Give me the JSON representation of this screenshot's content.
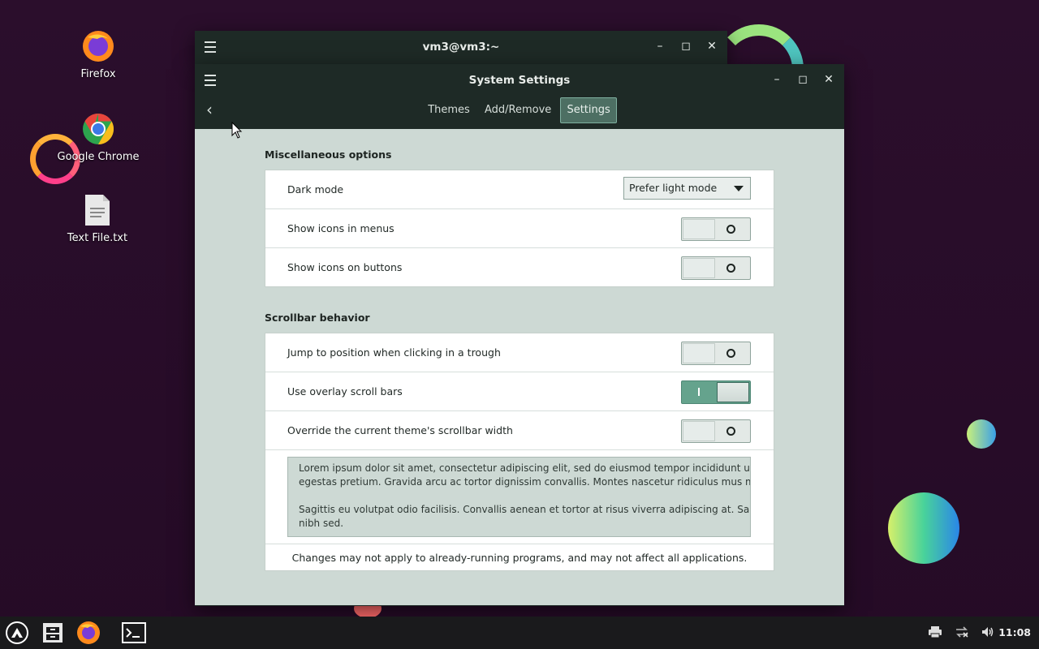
{
  "desktop": {
    "icons": [
      {
        "label": "Firefox",
        "icon": "firefox-icon"
      },
      {
        "label": "Google Chrome",
        "icon": "chrome-icon"
      },
      {
        "label": "Text File.txt",
        "icon": "text-file-icon"
      }
    ]
  },
  "terminal_window": {
    "title": "vm3@vm3:~",
    "buttons": {
      "minimize": "–",
      "maximize": "◻",
      "close": "✕"
    }
  },
  "settings_window": {
    "title": "System Settings",
    "buttons": {
      "minimize": "–",
      "maximize": "◻",
      "close": "✕"
    },
    "tabs": [
      {
        "label": "Themes",
        "active": false
      },
      {
        "label": "Add/Remove",
        "active": false
      },
      {
        "label": "Settings",
        "active": true
      }
    ],
    "sections": {
      "misc": {
        "heading": "Miscellaneous options",
        "dark_mode_label": "Dark mode",
        "dark_mode_value": "Prefer light mode",
        "icons_menus_label": "Show icons in menus",
        "icons_menus_on": false,
        "icons_buttons_label": "Show icons on buttons",
        "icons_buttons_on": false
      },
      "scrollbar": {
        "heading": "Scrollbar behavior",
        "jump_label": "Jump to position when clicking in a trough",
        "jump_on": false,
        "overlay_label": "Use overlay scroll bars",
        "overlay_on": true,
        "override_label": "Override the current theme's scrollbar width",
        "override_on": false,
        "sample_text": [
          "Lorem ipsum dolor sit amet, consectetur adipiscing elit, sed do eiusmod tempor incididunt ut labore e",
          "egestas pretium. Gravida arcu ac tortor dignissim convallis. Montes nascetur ridiculus mus mauris vi",
          "",
          "Sagittis eu volutpat odio facilisis. Convallis aenean et tortor at risus viverra adipiscing at. Sapien et lig",
          "nibh sed."
        ],
        "note": "Changes may not apply to already-running programs, and may not affect all applications."
      }
    }
  },
  "taskbar": {
    "apps": [
      "launcher-icon",
      "file-manager-icon",
      "firefox-icon",
      "terminal-icon"
    ],
    "tray": [
      "printer-icon",
      "network-disconnected-icon",
      "volume-icon"
    ],
    "clock": "11:08"
  },
  "colors": {
    "window_header": "#1e2a26",
    "content_bg": "#cdd9d4",
    "accent": "#65a38d"
  }
}
